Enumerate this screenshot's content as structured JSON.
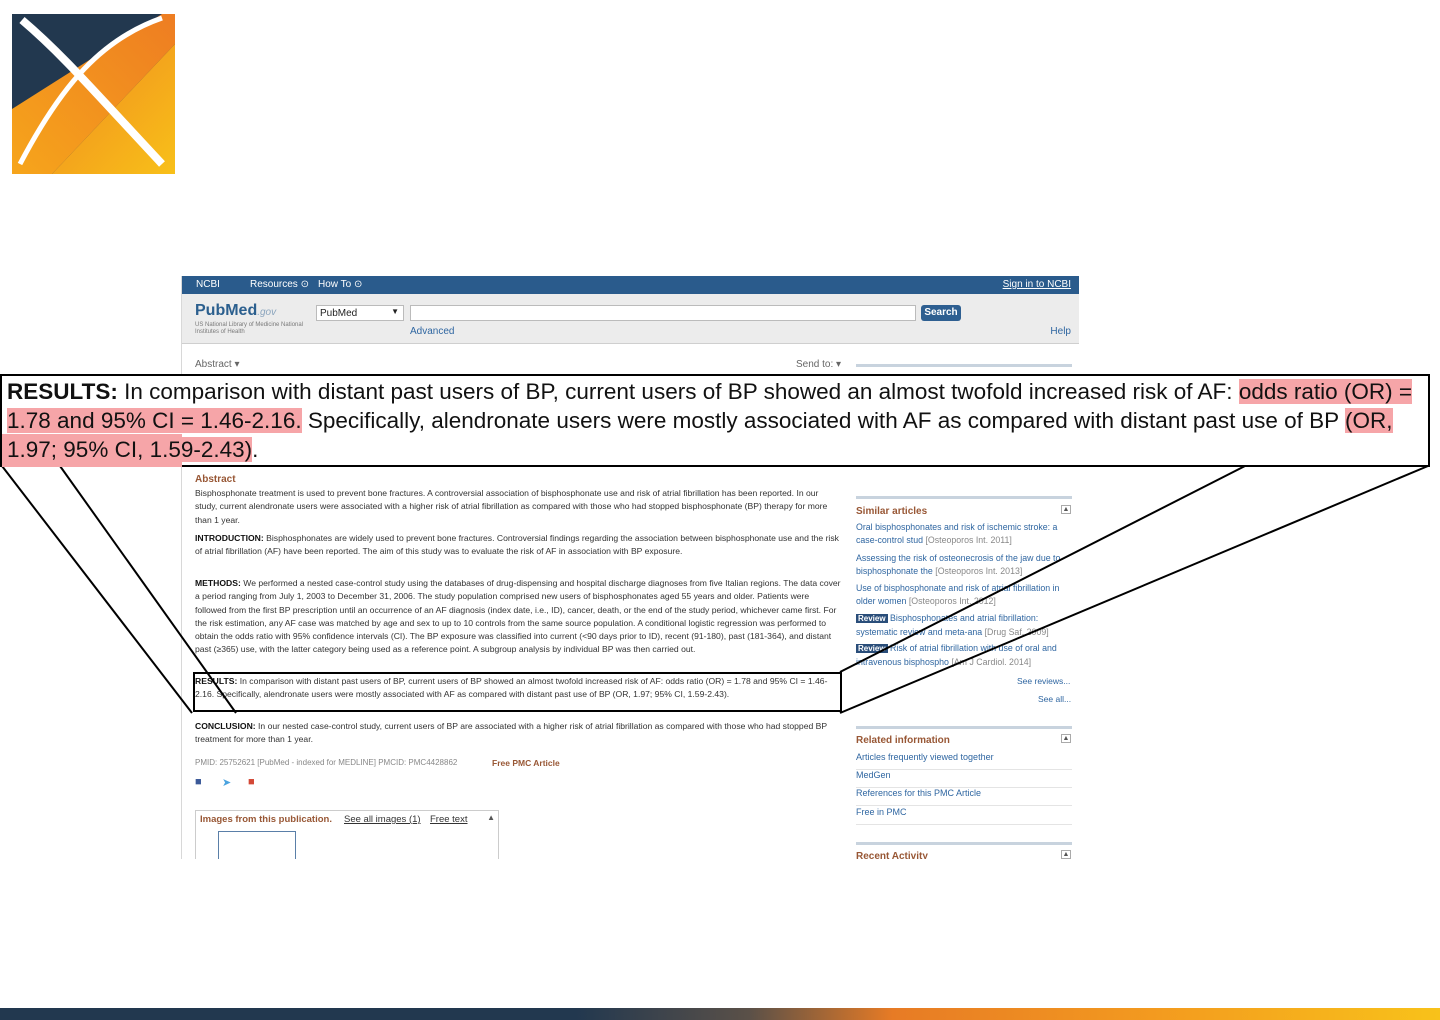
{
  "ncbi_bar": {
    "ncbi_label": "NCBI",
    "resources_label": "Resources",
    "howto_label": "How To",
    "signin_label": "Sign in to NCBI"
  },
  "header": {
    "logo_main": "PubMed",
    "logo_gov": ".gov",
    "logo_sub": "US National Library of Medicine National Institutes of Health",
    "db_select_value": "PubMed",
    "search_button": "Search",
    "advanced_label": "Advanced",
    "help_label": "Help"
  },
  "toolbar": {
    "abstract_label": "Abstract ▾",
    "sendto_label": "Send to: ▾"
  },
  "article": {
    "abstract_heading": "Abstract",
    "intro_text": "Bisphosphonate treatment is used to prevent bone fractures. A controversial association of bisphosphonate use and risk of atrial fibrillation has been reported. In our study, current alendronate users were associated with a higher risk of atrial fibrillation as compared with those who had stopped bisphosphonate (BP) therapy for more than 1 year.",
    "introduction_label": "INTRODUCTION:",
    "introduction_text": "Bisphosphonates are widely used to prevent bone fractures. Controversial findings regarding the association between bisphosphonate use and the risk of atrial fibrillation (AF) have been reported. The aim of this study was to evaluate the risk of AF in association with BP exposure.",
    "methods_label": "METHODS:",
    "methods_text": "We performed a nested case-control study using the databases of drug-dispensing and hospital discharge diagnoses from five Italian regions. The data cover a period ranging from July 1, 2003 to December 31, 2006. The study population comprised new users of bisphosphonates aged 55 years and older. Patients were followed from the first BP prescription until an occurrence of an AF diagnosis (index date, i.e., ID), cancer, death, or the end of the study period, whichever came first. For the risk estimation, any AF case was matched by age and sex to up to 10 controls from the same source population. A conditional logistic regression was performed to obtain the odds ratio with 95% confidence intervals (CI). The BP exposure was classified into current (<90 days prior to ID), recent (91-180), past (181-364), and distant past (≥365) use, with the latter category being used as a reference point. A subgroup analysis by individual BP was then carried out.",
    "results_label": "RESULTS:",
    "results_text": "In comparison with distant past users of BP, current users of BP showed an almost twofold increased risk of AF: odds ratio (OR) = 1.78 and 95% CI = 1.46-2.16. Specifically, alendronate users were mostly associated with AF as compared with distant past use of BP (OR, 1.97; 95% CI, 1.59-2.43).",
    "conclusion_label": "CONCLUSION:",
    "conclusion_text": "In our nested case-control study, current users of BP are associated with a higher risk of atrial fibrillation as compared with those who had stopped BP treatment for more than 1 year.",
    "meta_line": "PMID: 25752621 [PubMed - indexed for MEDLINE]   PMCID: PMC4428862",
    "free_pmc": "Free PMC Article",
    "images_title": "Images from this publication.",
    "see_all_images": "See all images (1)",
    "free_text": "Free text"
  },
  "sidebar": {
    "similar_title": "Similar articles",
    "similar": [
      {
        "title": "Oral bisphosphonates and risk of ischemic stroke: a case-control stud",
        "src": "[Osteoporos Int. 2011]"
      },
      {
        "title": "Assessing the risk of osteonecrosis of the jaw due to bisphosphonate the",
        "src": "[Osteoporos Int. 2013]"
      },
      {
        "title": "Use of bisphosphonate and risk of atrial fibrillation in older women",
        "src": "[Osteoporos Int. 2012]"
      },
      {
        "title": "Bisphosphonates and atrial fibrillation: systematic review and meta-ana",
        "src": "[Drug Saf. 2009]",
        "badge": "Review"
      },
      {
        "title": "Risk of atrial fibrillation with use of oral and intravenous bisphospho",
        "src": "[Am J Cardiol. 2014]",
        "badge": "Review"
      }
    ],
    "see_reviews": "See reviews...",
    "see_all": "See all...",
    "related_title": "Related information",
    "related": [
      "Articles frequently viewed together",
      "MedGen",
      "References for this PMC Article",
      "Free in PMC"
    ],
    "recent_title": "Recent Activity"
  },
  "callout": {
    "results_label": "RESULTS:",
    "part1": " In comparison with distant past users of BP, current users of BP showed an almost twofold increased risk of AF: ",
    "hl1": "odds ratio (OR) = 1.78 and 95% CI = 1.46-2.16.",
    "part2": " Specifically, alendronate users were mostly associated with AF as compared with distant past use of BP ",
    "hl2": "(OR, 1.97; 95% CI, 1.59-2.43)",
    "part3": "."
  },
  "colors": {
    "highlight": "#f6a5a8",
    "ncbi_blue": "#2a5b8c",
    "heading_brown": "#985735",
    "logo_navy": "#22384f",
    "logo_orange": "#f39a1f"
  }
}
